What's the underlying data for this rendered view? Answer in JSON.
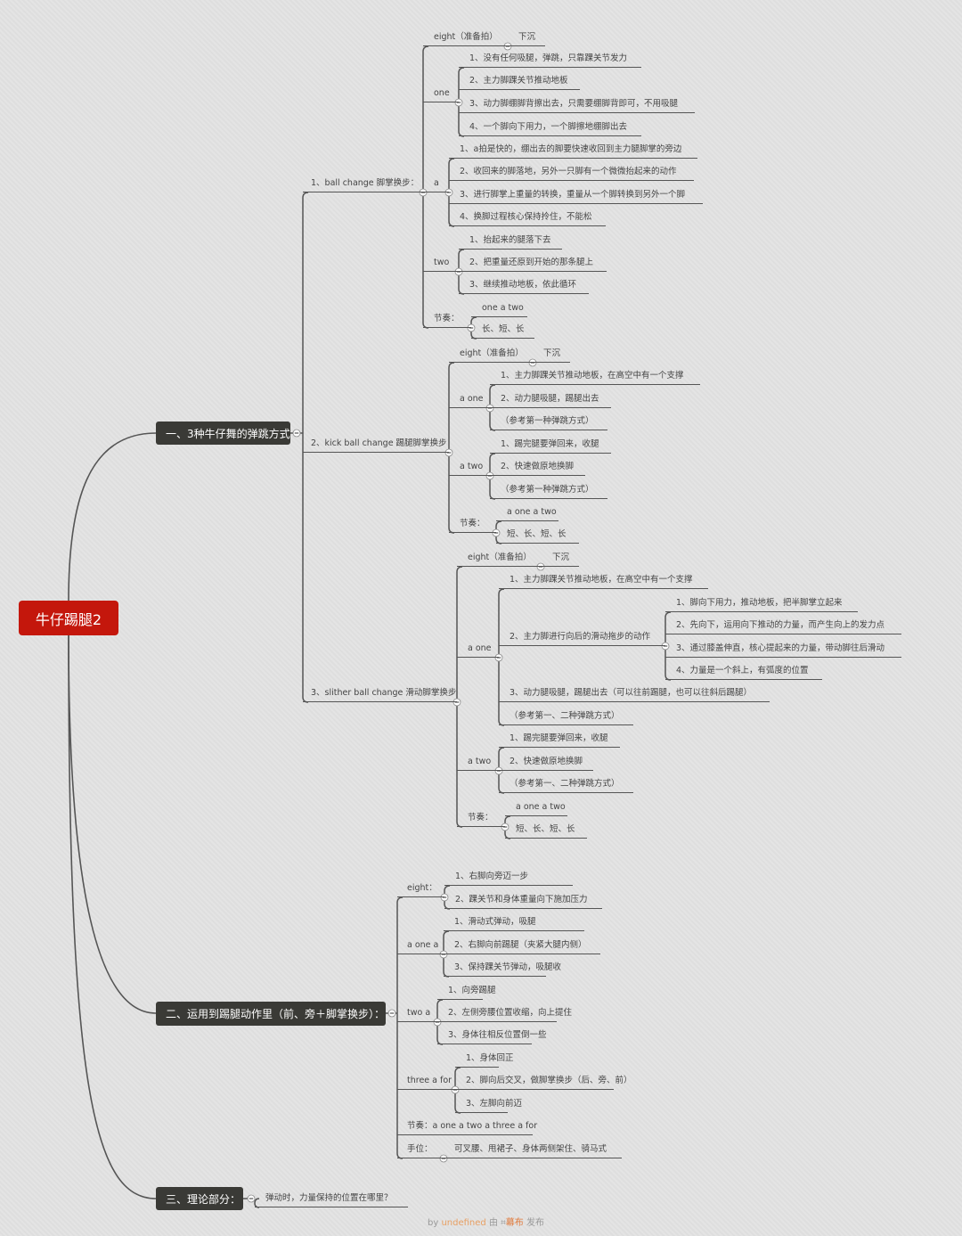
{
  "root": "牛仔踢腿2",
  "s1": {
    "title": "一、3种牛仔舞的弹跳方式",
    "b1": {
      "label": "1、ball change 脚掌换步：",
      "eight": {
        "label": "eight（准备拍）",
        "value": "下沉"
      },
      "one": {
        "label": "one",
        "items": [
          "1、没有任何吸腿，弹跳，只靠踝关节发力",
          "2、主力脚踝关节推动地板",
          "3、动力脚绷脚背擦出去，只需要绷脚背即可，不用吸腿",
          "4、一个脚向下用力，一个脚擦地绷脚出去"
        ]
      },
      "a": {
        "label": "a",
        "items": [
          "1、a拍是快的，绷出去的脚要快速收回到主力腿脚掌的旁边",
          "2、收回来的脚落地，另外一只脚有一个微微抬起来的动作",
          "3、进行脚掌上重量的转换，重量从一个脚转换到另外一个脚",
          "4、换脚过程核心保持拎住，不能松"
        ]
      },
      "two": {
        "label": "two",
        "items": [
          "1、抬起来的腿落下去",
          "2、把重量还原到开始的那条腿上",
          "3、继续推动地板，依此循环"
        ]
      },
      "rhythm": {
        "label": "节奏：",
        "items": [
          "one a two",
          "长、短、长"
        ]
      }
    },
    "b2": {
      "label": "2、kick ball change 踢腿脚掌换步",
      "eight": {
        "label": "eight（准备拍）",
        "value": "下沉"
      },
      "a_one": {
        "label": "a one",
        "items": [
          "1、主力脚踝关节推动地板，在高空中有一个支撑",
          "2、动力腿吸腿，踢腿出去",
          "（参考第一种弹跳方式）"
        ]
      },
      "a_two": {
        "label": "a two",
        "items": [
          "1、踢完腿要弹回来，收腿",
          "2、快速做原地换脚",
          "（参考第一种弹跳方式）"
        ]
      },
      "rhythm": {
        "label": "节奏：",
        "items": [
          "a one a two",
          "短、长、短、长"
        ]
      }
    },
    "b3": {
      "label": "3、slither ball change 滑动脚掌换步",
      "eight": {
        "label": "eight（准备拍）",
        "value": "下沉"
      },
      "a_one": {
        "label": "a one",
        "i1": "1、主力脚踝关节推动地板，在高空中有一个支撑",
        "i2": {
          "label": "2、主力脚进行向后的滑动拖步的动作",
          "items": [
            "1、脚向下用力，推动地板，把半脚掌立起来",
            "2、先向下，运用向下推动的力量，而产生向上的发力点",
            "3、通过膝盖伸直，核心提起来的力量，带动脚往后滑动",
            "4、力量是一个斜上，有弧度的位置"
          ]
        },
        "i3": "3、动力腿吸腿，踢腿出去（可以往前踢腿，也可以往斜后踢腿）",
        "i4": "（参考第一、二种弹跳方式）"
      },
      "a_two": {
        "label": "a two",
        "items": [
          "1、踢完腿要弹回来，收腿",
          "2、快速做原地换脚",
          "（参考第一、二种弹跳方式）"
        ]
      },
      "rhythm": {
        "label": "节奏：",
        "items": [
          "a one a two",
          "短、长、短、长"
        ]
      }
    }
  },
  "s2": {
    "title": "二、运用到踢腿动作里（前、旁＋脚掌换步）：",
    "eight": {
      "label": "eight：",
      "items": [
        "1、右脚向旁迈一步",
        "2、踝关节和身体重量向下施加压力"
      ]
    },
    "a_one_a": {
      "label": "a one a",
      "items": [
        "1、滑动式弹动，吸腿",
        "2、右脚向前踢腿（夹紧大腿内侧）",
        "3、保持踝关节弹动，吸腿收"
      ]
    },
    "two_a": {
      "label": "two a",
      "items": [
        "1、向旁踢腿",
        "2、左侧旁腰位置收缩，向上提住",
        "3、身体往相反位置倒一些"
      ]
    },
    "three_a_for": {
      "label": "three a for",
      "items": [
        "1、身体回正",
        "2、脚向后交叉，做脚掌换步（后、旁、前）",
        "3、左脚向前迈"
      ]
    },
    "rhythm": "节奏：a one a two a three a for",
    "hands": {
      "label": "手位：",
      "value": "可叉腰、甩裙子、身体两侧架住、骑马式"
    }
  },
  "s3": {
    "title": "三、理论部分：",
    "question": "弹动时，力量保持的位置在哪里？"
  },
  "footer": {
    "by": "by ",
    "user": "undefined",
    "mid": " 由 ",
    "logo": "⌗",
    "brand": "幕布",
    "end": " 发布"
  },
  "colors": {
    "background": "#e2e2e2",
    "root": "#c4170c",
    "section": "#3a3a36",
    "line": "#555555",
    "brand": "#e07a3c"
  }
}
